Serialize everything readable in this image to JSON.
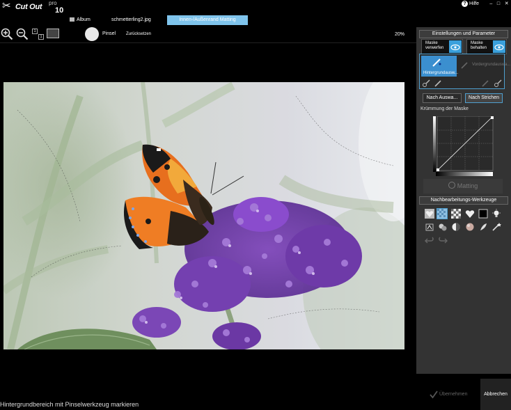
{
  "app": {
    "logo_text": "Cut Out",
    "edition": "pro",
    "version": "10"
  },
  "header": {
    "tabs": [
      {
        "label": "Album"
      },
      {
        "label": "schmetterling2.jpg"
      },
      {
        "label": "Innen-/Außenrand Matting"
      }
    ],
    "help_label": "Hilfe",
    "window_controls": [
      "–",
      "□",
      "✕"
    ]
  },
  "toolbar": {
    "fit_labels": [
      "1",
      "1"
    ],
    "brush_label": "Pinsel",
    "reset_label": "Zurücksetzen",
    "zoom_level": "20%"
  },
  "panel": {
    "settings_title": "Einstellungen und Parameter",
    "discard_mask": "Maske verwerfen",
    "keep_mask": "Maske behalten",
    "background_tool": "Hintergrundausw...",
    "foreground_tool": "Vordergrundauswa...",
    "by_selection": "Nach Auswa...",
    "by_strokes": "Nach Strichen",
    "curve_title": "Krümmung der Maske",
    "matting_button": "Matting",
    "postproc_title": "Nachbearbeitungs-Werkzeuge"
  },
  "footer": {
    "status": "Hintergrundbereich mit Pinselwerkzeug markieren",
    "apply": "Übernehmen",
    "cancel": "Abbrechen"
  },
  "colors": {
    "accent": "#7fc4ec",
    "panel_bg": "#333333",
    "selected_tool": "#3b8fcf",
    "app_bg": "#000000"
  }
}
